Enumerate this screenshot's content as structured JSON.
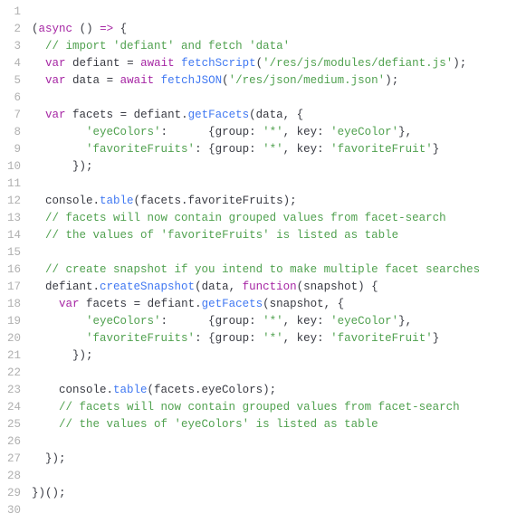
{
  "start_line": 1,
  "lines": [
    [],
    [
      {
        "t": "(",
        "c": "punct"
      },
      {
        "t": "async",
        "c": "keyword"
      },
      {
        "t": " ",
        "c": ""
      },
      {
        "t": "()",
        "c": "punct"
      },
      {
        "t": " ",
        "c": ""
      },
      {
        "t": "=>",
        "c": "keyword"
      },
      {
        "t": " ",
        "c": ""
      },
      {
        "t": "{",
        "c": "punct"
      }
    ],
    [
      {
        "t": "  ",
        "c": ""
      },
      {
        "t": "// import 'defiant' and fetch 'data'",
        "c": "comment"
      }
    ],
    [
      {
        "t": "  ",
        "c": ""
      },
      {
        "t": "var",
        "c": "keyword"
      },
      {
        "t": " defiant ",
        "c": ""
      },
      {
        "t": "=",
        "c": "punct"
      },
      {
        "t": " ",
        "c": ""
      },
      {
        "t": "await",
        "c": "keyword"
      },
      {
        "t": " ",
        "c": ""
      },
      {
        "t": "fetchScript",
        "c": "func"
      },
      {
        "t": "(",
        "c": "punct"
      },
      {
        "t": "'/res/js/modules/defiant.js'",
        "c": "string"
      },
      {
        "t": ");",
        "c": "punct"
      }
    ],
    [
      {
        "t": "  ",
        "c": ""
      },
      {
        "t": "var",
        "c": "keyword"
      },
      {
        "t": " data ",
        "c": ""
      },
      {
        "t": "=",
        "c": "punct"
      },
      {
        "t": " ",
        "c": ""
      },
      {
        "t": "await",
        "c": "keyword"
      },
      {
        "t": " ",
        "c": ""
      },
      {
        "t": "fetchJSON",
        "c": "func"
      },
      {
        "t": "(",
        "c": "punct"
      },
      {
        "t": "'/res/json/medium.json'",
        "c": "string"
      },
      {
        "t": ");",
        "c": "punct"
      }
    ],
    [],
    [
      {
        "t": "  ",
        "c": ""
      },
      {
        "t": "var",
        "c": "keyword"
      },
      {
        "t": " facets ",
        "c": ""
      },
      {
        "t": "=",
        "c": "punct"
      },
      {
        "t": " defiant.",
        "c": ""
      },
      {
        "t": "getFacets",
        "c": "func"
      },
      {
        "t": "(data, {",
        "c": "punct"
      }
    ],
    [
      {
        "t": "        ",
        "c": ""
      },
      {
        "t": "'eyeColors'",
        "c": "string"
      },
      {
        "t": ":      {",
        "c": "punct"
      },
      {
        "t": "group",
        "c": "prop"
      },
      {
        "t": ": ",
        "c": "punct"
      },
      {
        "t": "'*'",
        "c": "string"
      },
      {
        "t": ", ",
        "c": "punct"
      },
      {
        "t": "key",
        "c": "prop"
      },
      {
        "t": ": ",
        "c": "punct"
      },
      {
        "t": "'eyeColor'",
        "c": "string"
      },
      {
        "t": "},",
        "c": "punct"
      }
    ],
    [
      {
        "t": "        ",
        "c": ""
      },
      {
        "t": "'favoriteFruits'",
        "c": "string"
      },
      {
        "t": ": {",
        "c": "punct"
      },
      {
        "t": "group",
        "c": "prop"
      },
      {
        "t": ": ",
        "c": "punct"
      },
      {
        "t": "'*'",
        "c": "string"
      },
      {
        "t": ", ",
        "c": "punct"
      },
      {
        "t": "key",
        "c": "prop"
      },
      {
        "t": ": ",
        "c": "punct"
      },
      {
        "t": "'favoriteFruit'",
        "c": "string"
      },
      {
        "t": "}",
        "c": "punct"
      }
    ],
    [
      {
        "t": "      });",
        "c": "punct"
      }
    ],
    [],
    [
      {
        "t": "  console.",
        "c": ""
      },
      {
        "t": "table",
        "c": "func"
      },
      {
        "t": "(facets.favoriteFruits);",
        "c": "punct"
      }
    ],
    [
      {
        "t": "  ",
        "c": ""
      },
      {
        "t": "// facets will now contain grouped values from facet-search",
        "c": "comment"
      }
    ],
    [
      {
        "t": "  ",
        "c": ""
      },
      {
        "t": "// the values of 'favoriteFruits' is listed as table",
        "c": "comment"
      }
    ],
    [],
    [
      {
        "t": "  ",
        "c": ""
      },
      {
        "t": "// create snapshot if you intend to make multiple facet searches",
        "c": "comment"
      }
    ],
    [
      {
        "t": "  defiant.",
        "c": ""
      },
      {
        "t": "createSnapshot",
        "c": "func"
      },
      {
        "t": "(data, ",
        "c": "punct"
      },
      {
        "t": "function",
        "c": "keyword"
      },
      {
        "t": "(",
        "c": "punct"
      },
      {
        "t": "snapshot",
        "c": ""
      },
      {
        "t": ") {",
        "c": "punct"
      }
    ],
    [
      {
        "t": "    ",
        "c": ""
      },
      {
        "t": "var",
        "c": "keyword"
      },
      {
        "t": " facets ",
        "c": ""
      },
      {
        "t": "=",
        "c": "punct"
      },
      {
        "t": " defiant.",
        "c": ""
      },
      {
        "t": "getFacets",
        "c": "func"
      },
      {
        "t": "(snapshot, {",
        "c": "punct"
      }
    ],
    [
      {
        "t": "        ",
        "c": ""
      },
      {
        "t": "'eyeColors'",
        "c": "string"
      },
      {
        "t": ":      {",
        "c": "punct"
      },
      {
        "t": "group",
        "c": "prop"
      },
      {
        "t": ": ",
        "c": "punct"
      },
      {
        "t": "'*'",
        "c": "string"
      },
      {
        "t": ", ",
        "c": "punct"
      },
      {
        "t": "key",
        "c": "prop"
      },
      {
        "t": ": ",
        "c": "punct"
      },
      {
        "t": "'eyeColor'",
        "c": "string"
      },
      {
        "t": "},",
        "c": "punct"
      }
    ],
    [
      {
        "t": "        ",
        "c": ""
      },
      {
        "t": "'favoriteFruits'",
        "c": "string"
      },
      {
        "t": ": {",
        "c": "punct"
      },
      {
        "t": "group",
        "c": "prop"
      },
      {
        "t": ": ",
        "c": "punct"
      },
      {
        "t": "'*'",
        "c": "string"
      },
      {
        "t": ", ",
        "c": "punct"
      },
      {
        "t": "key",
        "c": "prop"
      },
      {
        "t": ": ",
        "c": "punct"
      },
      {
        "t": "'favoriteFruit'",
        "c": "string"
      },
      {
        "t": "}",
        "c": "punct"
      }
    ],
    [
      {
        "t": "      });",
        "c": "punct"
      }
    ],
    [],
    [
      {
        "t": "    console.",
        "c": ""
      },
      {
        "t": "table",
        "c": "func"
      },
      {
        "t": "(facets.eyeColors);",
        "c": "punct"
      }
    ],
    [
      {
        "t": "    ",
        "c": ""
      },
      {
        "t": "// facets will now contain grouped values from facet-search",
        "c": "comment"
      }
    ],
    [
      {
        "t": "    ",
        "c": ""
      },
      {
        "t": "// the values of 'eyeColors' is listed as table",
        "c": "comment"
      }
    ],
    [],
    [
      {
        "t": "  });",
        "c": "punct"
      }
    ],
    [],
    [
      {
        "t": "})();",
        "c": "punct"
      }
    ],
    []
  ]
}
